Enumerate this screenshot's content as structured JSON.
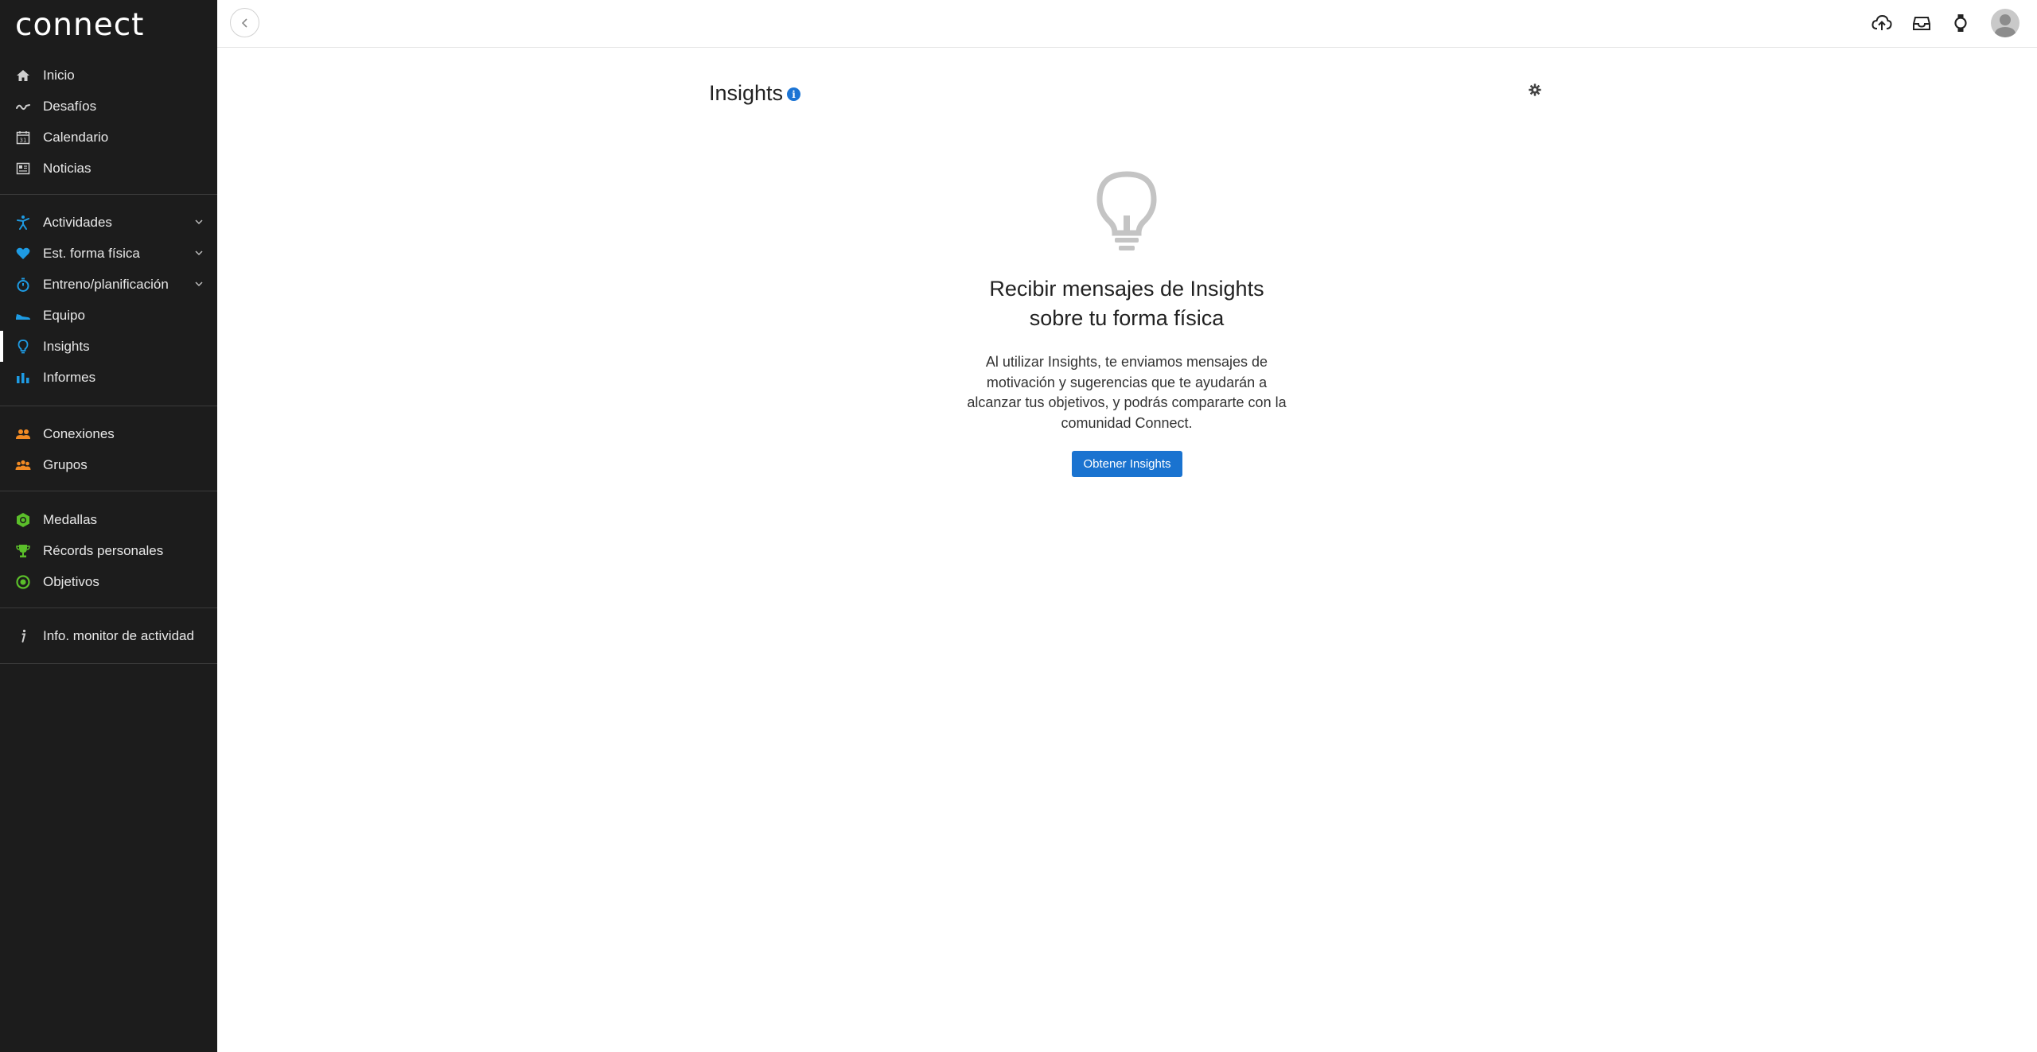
{
  "app": {
    "logo_text": "connect"
  },
  "sidebar": {
    "group1": [
      {
        "label": "Inicio",
        "icon": "home-icon"
      },
      {
        "label": "Desafíos",
        "icon": "challenge-icon"
      },
      {
        "label": "Calendario",
        "icon": "calendar-icon"
      },
      {
        "label": "Noticias",
        "icon": "news-icon"
      }
    ],
    "group2": [
      {
        "label": "Actividades",
        "icon": "activities-icon",
        "expandable": true
      },
      {
        "label": "Est. forma física",
        "icon": "heart-icon",
        "expandable": true
      },
      {
        "label": "Entreno/planificación",
        "icon": "stopwatch-icon",
        "expandable": true
      },
      {
        "label": "Equipo",
        "icon": "shoe-icon"
      },
      {
        "label": "Insights",
        "icon": "lightbulb-icon",
        "active": true
      },
      {
        "label": "Informes",
        "icon": "bar-chart-icon"
      }
    ],
    "group3": [
      {
        "label": "Conexiones",
        "icon": "connections-icon"
      },
      {
        "label": "Grupos",
        "icon": "groups-icon"
      }
    ],
    "group4": [
      {
        "label": "Medallas",
        "icon": "badge-icon"
      },
      {
        "label": "Récords personales",
        "icon": "trophy-icon"
      },
      {
        "label": "Objetivos",
        "icon": "target-icon"
      }
    ],
    "group5": [
      {
        "label": "Info. monitor de actividad",
        "icon": "info-icon"
      }
    ]
  },
  "topbar": {
    "icons": [
      "upload-icon",
      "inbox-icon",
      "watch-icon",
      "avatar"
    ]
  },
  "main": {
    "title": "Insights",
    "headline_line1": "Recibir mensajes de Insights",
    "headline_line2": "sobre tu forma física",
    "description": "Al utilizar Insights, te enviamos mensajes de motivación y sugerencias que te ayudarán a alcanzar tus objetivos, y podrás compararte con la comunidad Connect.",
    "cta_label": "Obtener Insights"
  },
  "colors": {
    "sidebar_bg": "#1c1c1c",
    "accent_blue": "#1a73d0",
    "icon_blue": "#1e9be3",
    "icon_orange": "#f08a24",
    "icon_green": "#5bbf2a"
  }
}
